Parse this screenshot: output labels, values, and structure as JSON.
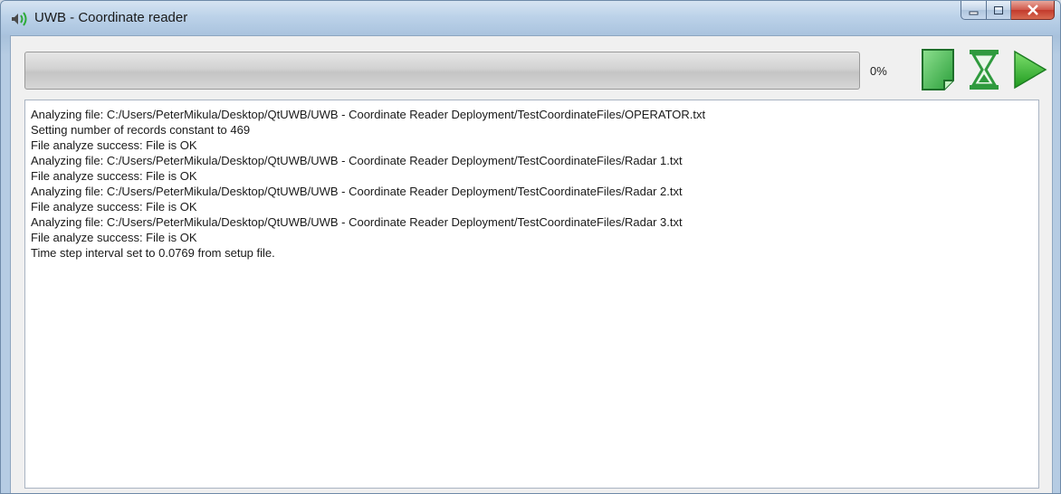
{
  "window": {
    "title": "UWB - Coordinate reader",
    "icon": "speaker-icon"
  },
  "title_buttons": {
    "minimize_icon": "minimize-icon",
    "maximize_icon": "maximize-icon",
    "close_icon": "close-icon"
  },
  "toolbar": {
    "progress_percent": 0,
    "progress_text": "0%",
    "buttons": [
      {
        "icon": "document-icon",
        "color": "#3bb34a"
      },
      {
        "icon": "hourglass-icon",
        "color": "#2f9a3e"
      },
      {
        "icon": "play-icon",
        "color": "#2fae2f"
      }
    ]
  },
  "log": {
    "lines": [
      "Analyzing file: C:/Users/PeterMikula/Desktop/QtUWB/UWB - Coordinate Reader Deployment/TestCoordinateFiles/OPERATOR.txt",
      "Setting number of records constant to 469",
      "File analyze success: File is OK",
      "Analyzing file: C:/Users/PeterMikula/Desktop/QtUWB/UWB - Coordinate Reader Deployment/TestCoordinateFiles/Radar 1.txt",
      "File analyze success: File is OK",
      "Analyzing file: C:/Users/PeterMikula/Desktop/QtUWB/UWB - Coordinate Reader Deployment/TestCoordinateFiles/Radar 2.txt",
      "File analyze success: File is OK",
      "Analyzing file: C:/Users/PeterMikula/Desktop/QtUWB/UWB - Coordinate Reader Deployment/TestCoordinateFiles/Radar 3.txt",
      "File analyze success: File is OK",
      "Time step interval set to 0.0769 from setup file."
    ]
  }
}
